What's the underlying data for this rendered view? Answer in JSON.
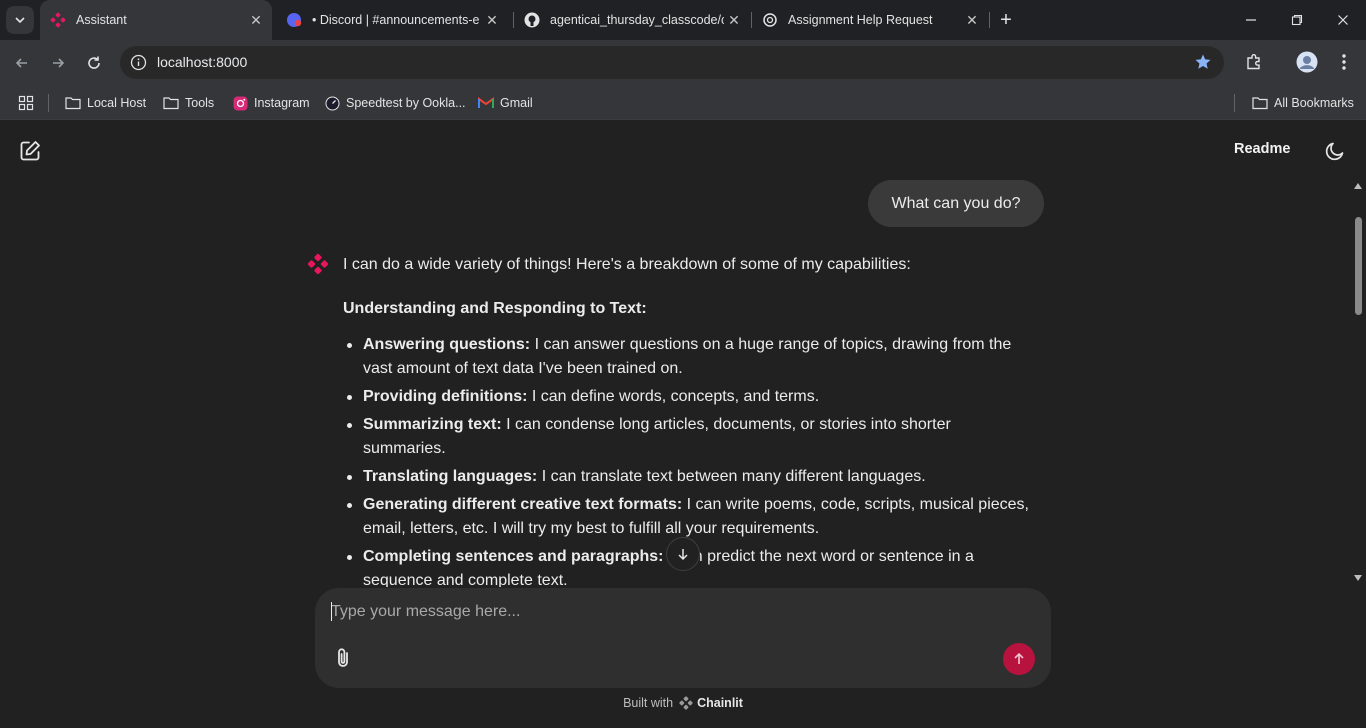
{
  "browser": {
    "tabs": [
      {
        "title": "Assistant",
        "active": true,
        "icon": "chainlit-logo-icon"
      },
      {
        "title": "• Discord | #announcements-e",
        "active": false,
        "icon": "discord-icon"
      },
      {
        "title": "agenticai_thursday_classcode/cl",
        "active": false,
        "icon": "github-icon"
      },
      {
        "title": "Assignment Help Request",
        "active": false,
        "icon": "chatgpt-icon"
      }
    ],
    "url": "localhost:8000",
    "bookmarks": [
      {
        "label": "Local Host",
        "icon": "folder-icon"
      },
      {
        "label": "Tools",
        "icon": "folder-icon"
      },
      {
        "label": "Instagram",
        "icon": "instagram-icon"
      },
      {
        "label": "Speedtest by Ookla...",
        "icon": "speedtest-icon"
      },
      {
        "label": "Gmail",
        "icon": "gmail-icon"
      }
    ],
    "all_bookmarks": "All Bookmarks"
  },
  "app": {
    "header": {
      "readme_label": "Readme"
    },
    "user_message": "What can you do?",
    "assistant": {
      "intro": "I can do a wide variety of things! Here's a breakdown of some of my capabilities:",
      "section_title": "Understanding and Responding to Text:",
      "items": [
        {
          "bold": "Answering questions:",
          "text": " I can answer questions on a huge range of topics, drawing from the vast amount of text data I've been trained on."
        },
        {
          "bold": "Providing definitions:",
          "text": " I can define words, concepts, and terms."
        },
        {
          "bold": "Summarizing text:",
          "text": " I can condense long articles, documents, or stories into shorter summaries."
        },
        {
          "bold": "Translating languages:",
          "text": " I can translate text between many different languages."
        },
        {
          "bold": "Generating different creative text formats:",
          "text": " I can write poems, code, scripts, musical pieces, email, letters, etc. I will try my best to fulfill all your requirements."
        },
        {
          "bold": "Completing sentences and paragraphs:",
          "text": " I can predict the next word or sentence in a sequence and complete text."
        }
      ]
    },
    "composer": {
      "placeholder": "Type your message here..."
    },
    "footer": {
      "built_with": "Built with",
      "brand": "Chainlit"
    },
    "colors": {
      "accent": "#b8123f",
      "background": "#212121"
    }
  }
}
